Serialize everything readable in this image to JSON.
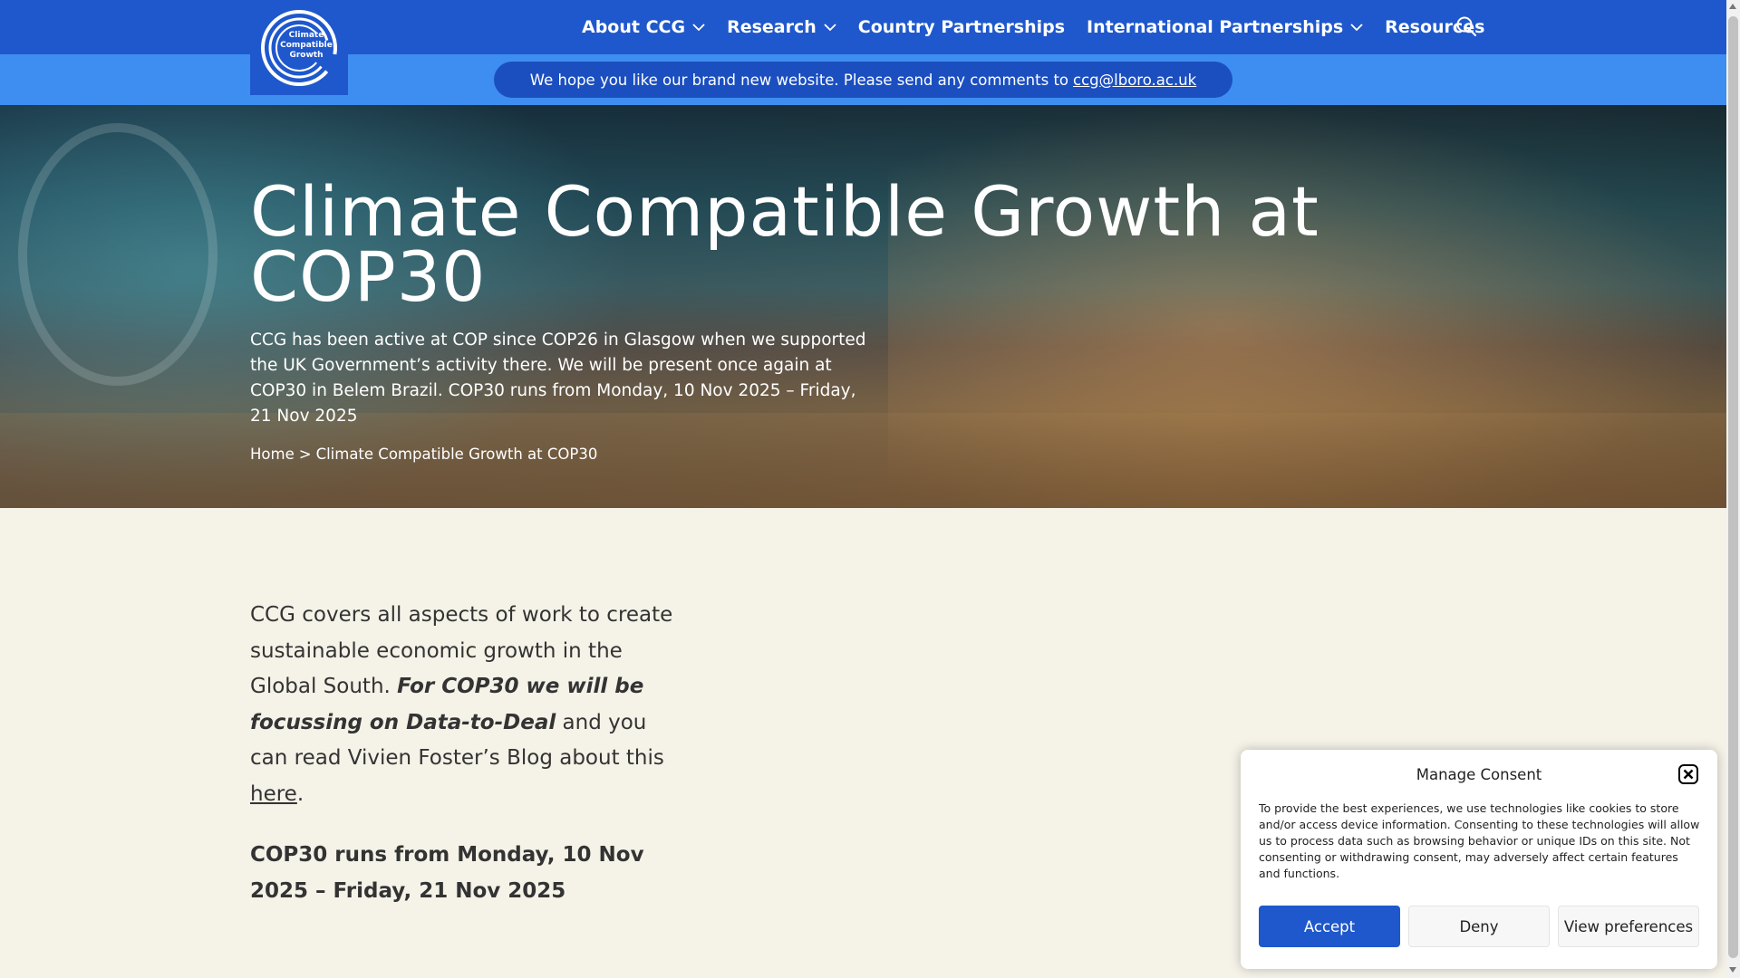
{
  "logo": {
    "line1": "Climate",
    "line2": "Compatible",
    "line3": "Growth"
  },
  "nav": {
    "items": [
      {
        "label": "About CCG",
        "dropdown": true
      },
      {
        "label": "Research",
        "dropdown": true
      },
      {
        "label": "Country Partnerships",
        "dropdown": false
      },
      {
        "label": "International Partnerships",
        "dropdown": true
      },
      {
        "label": "Resources",
        "dropdown": false
      }
    ],
    "search_icon": "search-icon"
  },
  "banner": {
    "text": "We hope you like our brand new website.  Please send any comments to",
    "email": "ccg@lboro.ac.uk"
  },
  "hero": {
    "title": "Climate Compatible Growth at COP30",
    "description": "CCG has been active at COP since COP26 in Glasgow when we supported the UK Government’s activity there.  We will be present once again at COP30 in Belem Brazil. COP30 runs from Monday, 10 Nov 2025 – Friday, 21 Nov 2025",
    "breadcrumb": {
      "home": "Home",
      "separator": ">",
      "current": "Climate Compatible Growth at COP30"
    }
  },
  "content": {
    "intro_before": "CCG covers all aspects of work to create sustainable economic growth in the Global South. ",
    "intro_bold": "For COP30 we will be focussing on Data-to-Deal",
    "intro_after": " and you can read Vivien Foster’s Blog about this ",
    "link_text": "here",
    "intro_end": ".",
    "dates": "COP30 runs from Monday, 10 Nov 2025 – Friday, 21 Nov 2025"
  },
  "consent": {
    "title": "Manage Consent",
    "text": "To provide the best experiences, we use technologies like cookies to store and/or access device information. Consenting to these technologies will allow us to process data such as browsing behavior or unique IDs on this site. Not consenting or withdrawing consent, may adversely affect certain features and functions.",
    "accept": "Accept",
    "deny": "Deny",
    "preferences": "View preferences"
  },
  "colors": {
    "nav_bg": "#1f58cc",
    "banner_bg": "#3d8ef0",
    "page_bg": "#f5f2e8",
    "accept_bg": "#1f58cc"
  }
}
